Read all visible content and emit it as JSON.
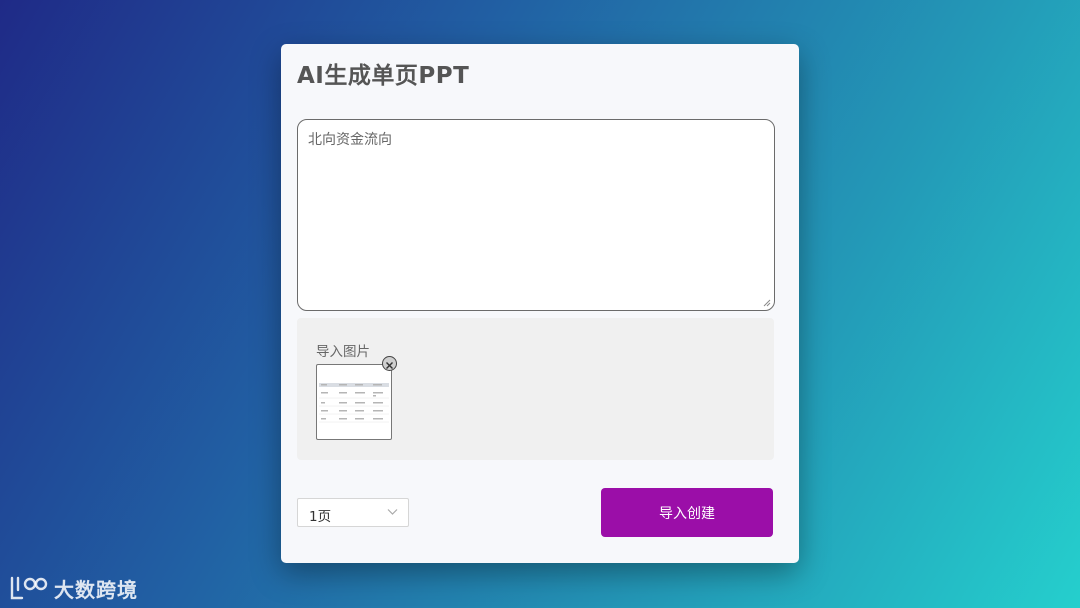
{
  "dialog": {
    "title": "AI生成单页PPT",
    "prompt_value": "北向资金流向",
    "image_section": {
      "label": "导入图片"
    },
    "page_select": {
      "selected": "1页"
    },
    "create_button_label": "导入创建"
  },
  "watermark": {
    "brand_name": "大数跨境"
  },
  "colors": {
    "accent_button": "#9b0ea8",
    "card_background": "#f7f8fb",
    "background_gradient_start": "#1f2a87",
    "background_gradient_end": "#25cfcd"
  },
  "icons": {
    "remove_image": "close-circle-icon",
    "select_chevron": "chevron-down-icon",
    "brand_logo": "brand-logo-icon"
  }
}
